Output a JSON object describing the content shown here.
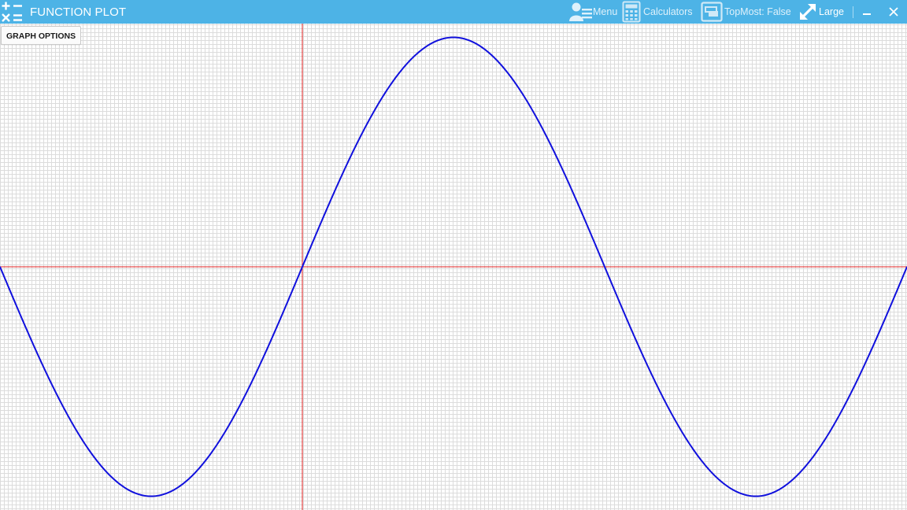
{
  "window": {
    "title": "FUNCTION PLOT",
    "accent_color": "#4db3e6"
  },
  "toolbar": {
    "menu_label": "Menu",
    "calculators_label": "Calculators",
    "topmost_label": "TopMost: False",
    "size_label": "Large"
  },
  "controls": {
    "graph_options_label": "GRAPH OPTIONS"
  },
  "icons": {
    "app": "calculator-operators-icon",
    "menu": "user-menu-icon",
    "calculators": "calculator-icon",
    "topmost": "window-stack-icon",
    "size": "resize-arrow-icon",
    "minimize": "minimize-icon",
    "close": "close-icon"
  },
  "chart_data": {
    "type": "line",
    "function": "sin(x)",
    "x_range": [
      -3.14159,
      6.2832
    ],
    "y_range": [
      -1.06,
      1.06
    ],
    "grid": true,
    "axes_color": "#e02020",
    "curve_color": "#1010dd",
    "grid_color": "#d9d9d9",
    "series": [
      {
        "x": [
          -3.14159,
          -1.5708,
          0,
          1.5708,
          3.14159,
          4.7124,
          6.2832
        ],
        "y": [
          0,
          -1,
          0,
          1,
          0,
          -1,
          0
        ]
      }
    ]
  }
}
